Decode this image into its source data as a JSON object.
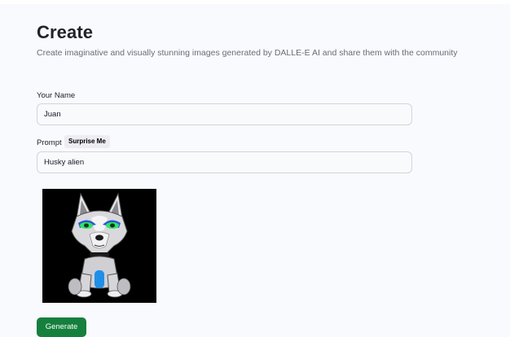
{
  "header": {
    "title": "Create",
    "subtitle": "Create imaginative and visually stunning images generated by DALLE-E AI and share them with the community"
  },
  "form": {
    "name_label": "Your Name",
    "name_value": "Juan",
    "prompt_label": "Prompt",
    "surprise_label": "Surprise Me",
    "prompt_value": "Husky alien",
    "generate_label": "Generate"
  },
  "preview": {
    "subject": "husky-alien-illustration",
    "background": "#000000"
  },
  "colors": {
    "accent": "#15803d",
    "page_background": "#f9fafe",
    "input_border": "#d1d5db"
  }
}
